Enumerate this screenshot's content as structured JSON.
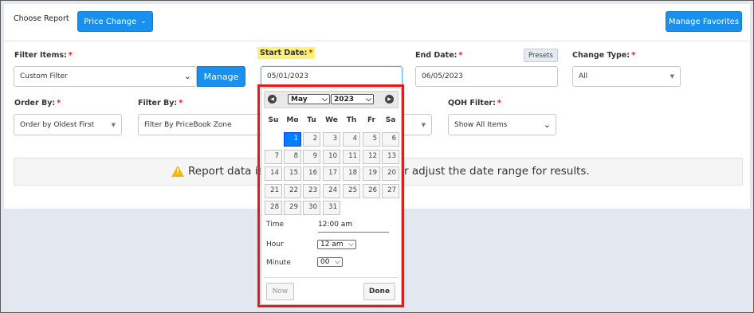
{
  "header": {
    "choose_report_label": "Choose Report",
    "report_select": "Price Change",
    "manage_favorites": "Manage Favorites"
  },
  "filters": {
    "filter_items": {
      "label": "Filter Items:",
      "value": "Custom Filter",
      "manage_label": "Manage"
    },
    "start_date": {
      "label": "Start Date:",
      "value": "05/01/2023"
    },
    "end_date": {
      "label": "End Date:",
      "value": "06/05/2023",
      "presets_label": "Presets"
    },
    "change_type": {
      "label": "Change Type:",
      "value": "All"
    },
    "order_by": {
      "label": "Order By:",
      "value": "Order by Oldest First"
    },
    "filter_by": {
      "label": "Filter By:",
      "value": "Filter By PriceBook Zone"
    },
    "qoh_filter": {
      "label": "QOH Filter:",
      "value": "Show All Items"
    },
    "required_mark": "*"
  },
  "alert": {
    "text_left": "Report data is",
    "text_right": "r adjust the date range for results.",
    "icon": "warning-icon",
    "icon_color": "#f2b705"
  },
  "datepicker": {
    "month": "May",
    "year": "2023",
    "weekdays": [
      "Su",
      "Mo",
      "Tu",
      "We",
      "Th",
      "Fr",
      "Sa"
    ],
    "days": [
      "1",
      "2",
      "3",
      "4",
      "5",
      "6",
      "7",
      "8",
      "9",
      "10",
      "11",
      "12",
      "13",
      "14",
      "15",
      "16",
      "17",
      "18",
      "19",
      "20",
      "21",
      "22",
      "23",
      "24",
      "25",
      "26",
      "27",
      "28",
      "29",
      "30",
      "31"
    ],
    "selected_day": "1",
    "time_label": "Time",
    "time_value": "12:00 am",
    "hour_label": "Hour",
    "hour_value": "12 am",
    "minute_label": "Minute",
    "minute_value": "00",
    "now_label": "Now",
    "done_label": "Done"
  },
  "colors": {
    "accent": "#1a90ee",
    "highlight": "#e21c1c",
    "required": "#e21c1c",
    "selected_day": "#007fff"
  }
}
